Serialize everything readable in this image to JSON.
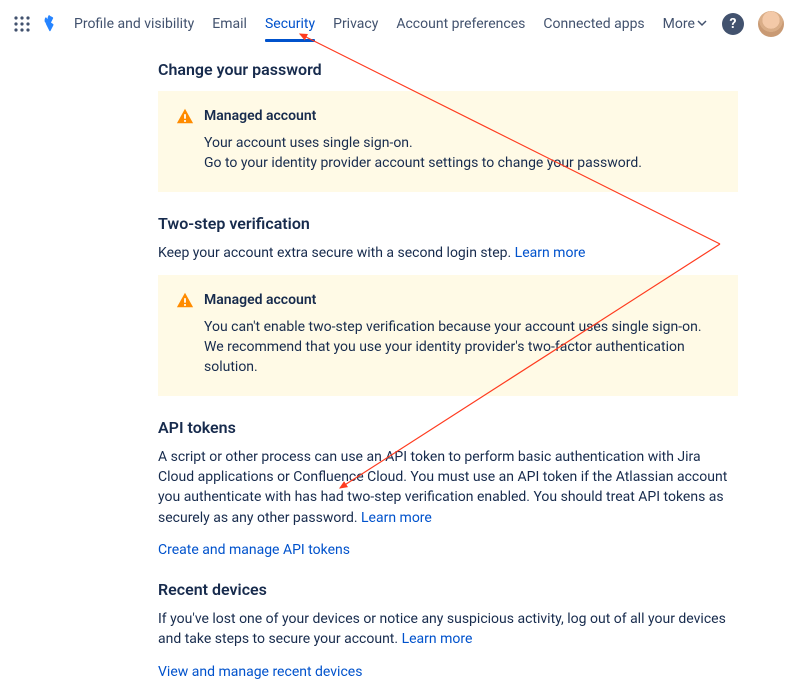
{
  "nav": {
    "tabs": [
      {
        "label": "Profile and visibility"
      },
      {
        "label": "Email"
      },
      {
        "label": "Security"
      },
      {
        "label": "Privacy"
      },
      {
        "label": "Account preferences"
      },
      {
        "label": "Connected apps"
      }
    ],
    "more": "More"
  },
  "section_password": {
    "title": "Change your password",
    "warn_title": "Managed account",
    "warn_body": "Your account uses single sign-on.\nGo to your identity provider account settings to change your password."
  },
  "section_twostep": {
    "title": "Two-step verification",
    "desc": "Keep your account extra secure with a second login step. ",
    "learn": "Learn more",
    "warn_title": "Managed account",
    "warn_body": "You can't enable two-step verification because your account uses single sign-on. We recommend that you use your identity provider's two-factor authentication solution."
  },
  "section_api": {
    "title": "API tokens",
    "desc": "A script or other process can use an API token to perform basic authentication with Jira Cloud applications or Confluence Cloud. You must use an API token if the Atlassian account you authenticate with has had two-step verification enabled. You should treat API tokens as securely as any other password. ",
    "learn": "Learn more",
    "action": "Create and manage API tokens"
  },
  "section_devices": {
    "title": "Recent devices",
    "desc": "If you've lost one of your devices or notice any suspicious activity, log out of all your devices and take steps to secure your account. ",
    "learn": "Learn more",
    "action": "View and manage recent devices"
  }
}
